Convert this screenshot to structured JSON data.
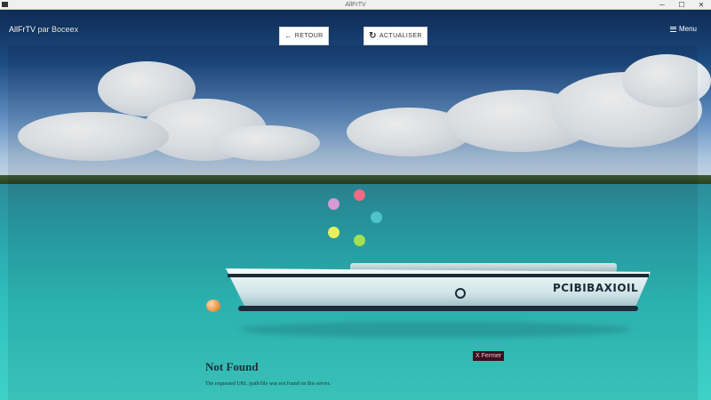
{
  "window": {
    "title": "AllFrTV",
    "minimize": "─",
    "maximize": "☐",
    "close": "✕"
  },
  "header": {
    "brand_name": "AllFrTV",
    "brand_sub": " par Boceex",
    "back_icon": "←",
    "back_label": "RETOUR",
    "refresh_icon": "↻",
    "refresh_label": "ACTUALISER",
    "menu_label": "Menu"
  },
  "boat": {
    "name": "PCIBIBAXIOIL"
  },
  "loader": {
    "colors": [
      "#ef6a82",
      "#4ec4c8",
      "#a3e052",
      "#e8f060",
      "#d79ad6"
    ]
  },
  "error": {
    "title": "Not Found",
    "message": "The requested URL /path/file was not found on this server.",
    "close_label": "X Fermer"
  },
  "icons": {
    "back": "arrow-left-icon",
    "refresh": "refresh-icon",
    "menu": "hamburger-icon"
  }
}
